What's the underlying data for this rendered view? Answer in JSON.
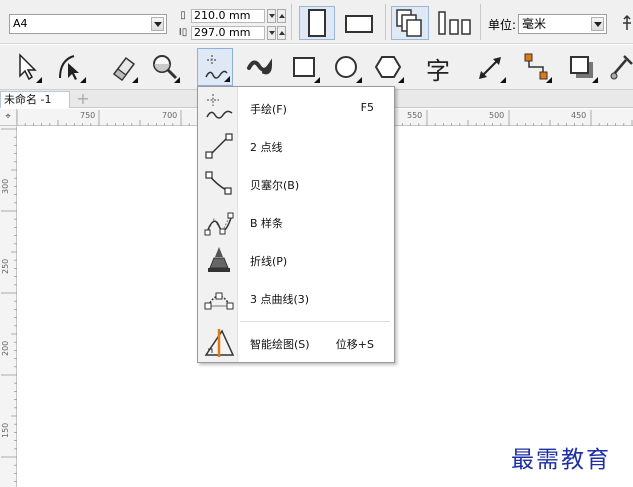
{
  "property_bar": {
    "page_size": "A4",
    "width_value": "210.0 mm",
    "height_value": "297.0 mm",
    "unit_label": "单位:",
    "unit_value": "毫米"
  },
  "document_tab": {
    "name": "未命名 -1",
    "add_symbol": "+"
  },
  "ruler": {
    "horizontal_labels": [
      "750",
      "700",
      "550",
      "500",
      "450"
    ],
    "vertical_labels": [
      "300",
      "250",
      "200",
      "150"
    ]
  },
  "curve_flyout": {
    "items": [
      {
        "label": "手绘(F)",
        "shortcut": "F5",
        "icon": "freehand-icon"
      },
      {
        "label": "2 点线",
        "shortcut": "",
        "icon": "two-point-line-icon"
      },
      {
        "label": "贝塞尔(B)",
        "shortcut": "",
        "icon": "bezier-icon"
      },
      {
        "label": "B 样条",
        "shortcut": "",
        "icon": "b-spline-icon"
      },
      {
        "label": "折线(P)",
        "shortcut": "",
        "icon": "polyline-icon"
      },
      {
        "label": "3 点曲线(3)",
        "shortcut": "",
        "icon": "three-point-curve-icon"
      },
      {
        "label": "智能绘图(S)",
        "shortcut": "位移+S",
        "icon": "smart-drawing-icon"
      }
    ]
  },
  "toolbox": {
    "text_tool_glyph": "字"
  },
  "watermark": "最需教育",
  "colors": {
    "accent_orange": "#e07a10",
    "watermark_blue": "#1c2fa6",
    "active_tool_bg": "#dfe9f5"
  }
}
